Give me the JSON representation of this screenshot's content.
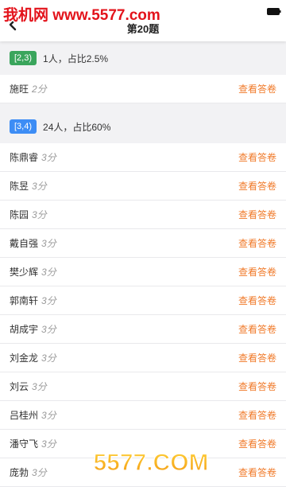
{
  "watermark_top": "我机网 www.5577.com",
  "watermark_bottom": "5577.COM",
  "nav": {
    "title": "第20题"
  },
  "colors": {
    "green_badge": "#3aa55c",
    "blue_badge": "#3d8df5",
    "link": "#f07a2a"
  },
  "groups": [
    {
      "range": "[2,3)",
      "summary": "1人，占比2.5%",
      "rows": [
        {
          "name": "施旺",
          "score": "2分",
          "action": "查看答卷"
        }
      ]
    },
    {
      "range": "[3,4)",
      "summary": "24人，占比60%",
      "rows": [
        {
          "name": "陈鼎睿",
          "score": "3分",
          "action": "查看答卷"
        },
        {
          "name": "陈昱",
          "score": "3分",
          "action": "查看答卷"
        },
        {
          "name": "陈园",
          "score": "3分",
          "action": "查看答卷"
        },
        {
          "name": "戴自强",
          "score": "3分",
          "action": "查看答卷"
        },
        {
          "name": "樊少辉",
          "score": "3分",
          "action": "查看答卷"
        },
        {
          "name": "郭南轩",
          "score": "3分",
          "action": "查看答卷"
        },
        {
          "name": "胡成宇",
          "score": "3分",
          "action": "查看答卷"
        },
        {
          "name": "刘金龙",
          "score": "3分",
          "action": "查看答卷"
        },
        {
          "name": "刘云",
          "score": "3分",
          "action": "查看答卷"
        },
        {
          "name": "吕桂州",
          "score": "3分",
          "action": "查看答卷"
        },
        {
          "name": "潘守飞",
          "score": "3分",
          "action": "查看答卷"
        },
        {
          "name": "庞勃",
          "score": "3分",
          "action": "查看答卷"
        }
      ]
    }
  ]
}
